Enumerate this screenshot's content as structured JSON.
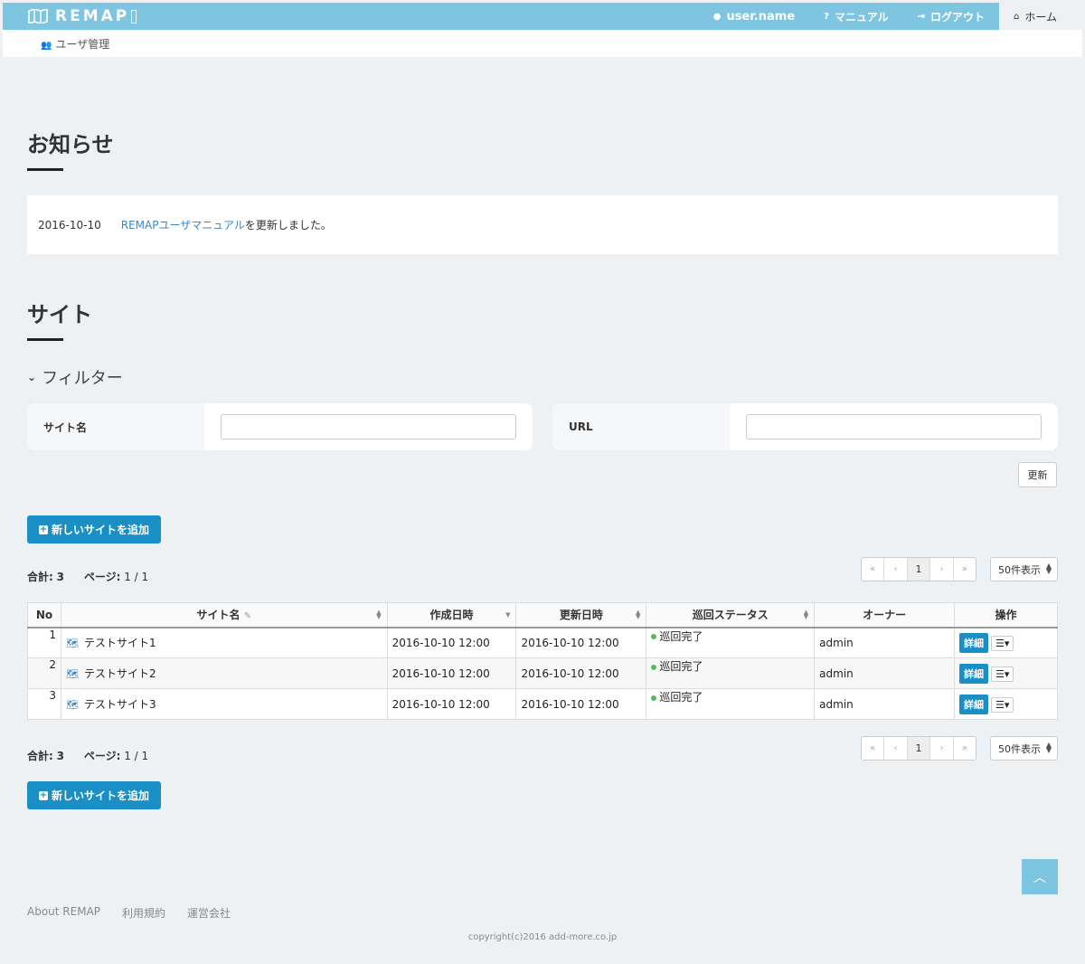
{
  "header": {
    "logo": "REMAP",
    "nav": {
      "user": "user.name",
      "manual": "マニュアル",
      "logout": "ログアウト",
      "home": "ホーム"
    },
    "subnav": {
      "user_admin": "ユーザ管理"
    }
  },
  "news": {
    "title": "お知らせ",
    "items": [
      {
        "date": "2016-10-10",
        "link_text": "REMAPユーザマニュアル",
        "suffix": "を更新しました。"
      }
    ]
  },
  "sites": {
    "title": "サイト",
    "filter": {
      "toggle_label": "フィルター",
      "site_name_label": "サイト名",
      "site_name_value": "",
      "url_label": "URL",
      "url_value": "",
      "update_button": "更新"
    },
    "add_button": "新しいサイトを追加",
    "summary": {
      "total_label": "合計:",
      "total": "3",
      "page_label": "ページ:",
      "page": "1 / 1"
    },
    "pager": {
      "first": "«",
      "prev": "‹",
      "current": "1",
      "next": "›",
      "last": "»"
    },
    "per_page": "50件表示",
    "columns": [
      "No",
      "サイト名",
      "作成日時",
      "更新日時",
      "巡回ステータス",
      "オーナー",
      "操作"
    ],
    "rows": [
      {
        "no": "1",
        "name": "テストサイト1",
        "created": "2016-10-10 12:00",
        "updated": "2016-10-10 12:00",
        "status": "巡回完了",
        "owner": "admin"
      },
      {
        "no": "2",
        "name": "テストサイト2",
        "created": "2016-10-10 12:00",
        "updated": "2016-10-10 12:00",
        "status": "巡回完了",
        "owner": "admin"
      },
      {
        "no": "3",
        "name": "テストサイト3",
        "created": "2016-10-10 12:00",
        "updated": "2016-10-10 12:00",
        "status": "巡回完了",
        "owner": "admin"
      }
    ],
    "detail_button": "詳細"
  },
  "footer": {
    "links": [
      "About REMAP",
      "利用規約",
      "運営会社"
    ],
    "copyright": "copyright(c)2016 add-more.co.jp"
  },
  "colors": {
    "accent": "#7ec5e1",
    "primary_button": "#1a8fc6",
    "link": "#3a87c8",
    "status_ok": "#5cb85c"
  },
  "icons": {
    "user": "user-icon",
    "manual": "question-circle-icon",
    "logout": "sign-out-icon",
    "home": "home-icon",
    "users": "users-icon",
    "site": "map-icon",
    "sort": "sort-icon",
    "back_to_top": "chevron-up-icon"
  }
}
